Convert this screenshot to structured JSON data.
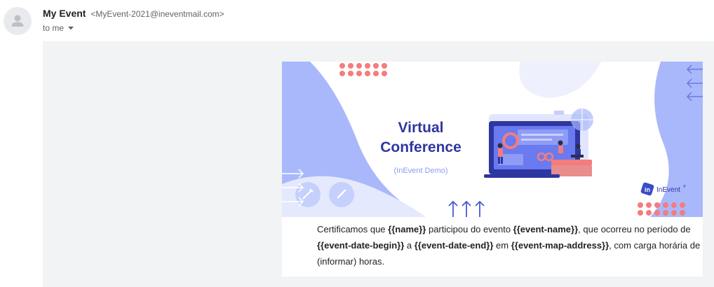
{
  "sender": {
    "name": "My Event",
    "email": "<MyEvent-2021@ineventmail.com>",
    "recipient_label": "to me"
  },
  "banner": {
    "title_line1": "Virtual",
    "title_line2": "Conference",
    "subtitle": "(InEvent Demo)",
    "logo_text": "InEvent",
    "logo_mark": "®"
  },
  "certificate": {
    "p1": "Certificamos que ",
    "name": "{{name}}",
    "p2": " participou do evento ",
    "event_name": "{{event-name}}",
    "p3": ", que ocorreu no período de ",
    "date_begin": "{{event-date-begin}}",
    "p4": " a ",
    "date_end": "{{event-date-end}}",
    "p5": " em ",
    "address": "{{event-map-address}}",
    "p6": ", com carga horária de (informar) horas."
  },
  "colors": {
    "accent_blue": "#2e36a1",
    "light_blue": "#a9b8fb",
    "pale_blue": "#e5e9fd",
    "coral": "#f47c7c",
    "background": "#f1f3f4"
  }
}
